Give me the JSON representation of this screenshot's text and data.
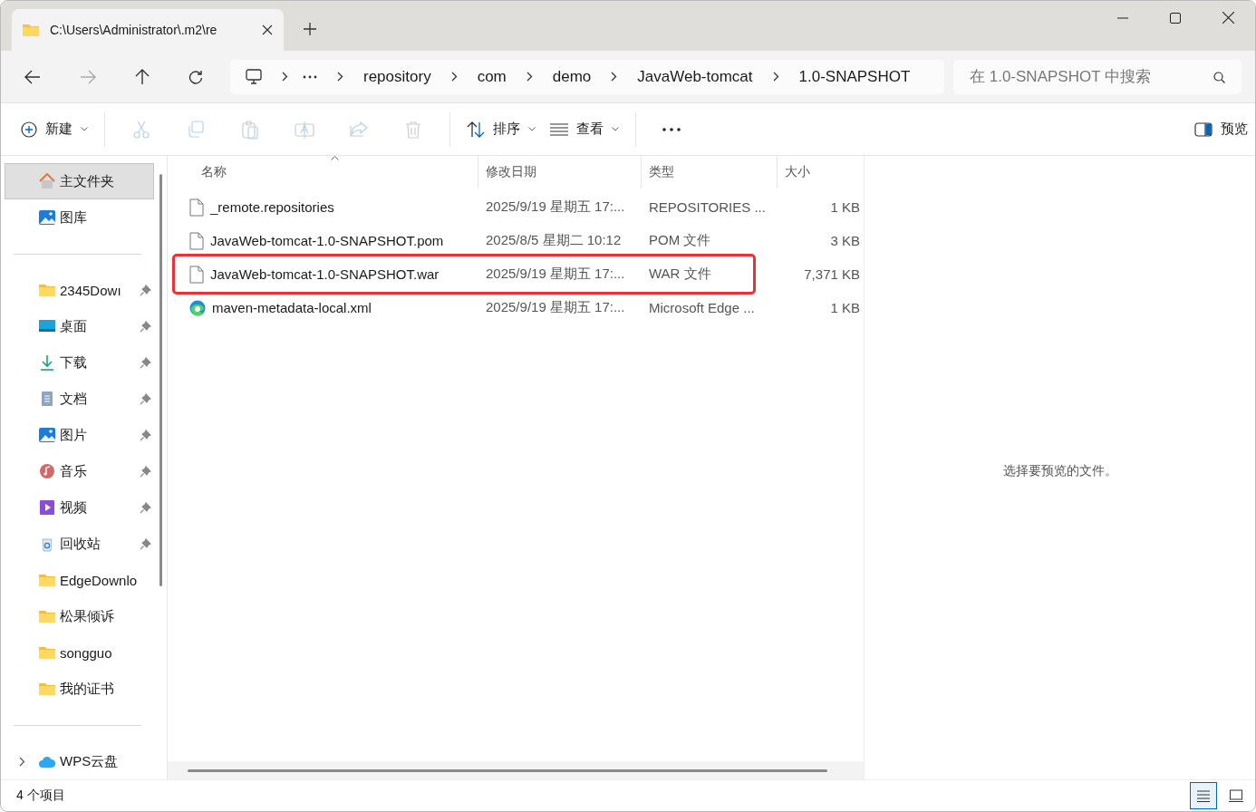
{
  "window": {
    "tab_title": "C:\\Users\\Administrator\\.m2\\re"
  },
  "navigation": {
    "forward_disabled": true
  },
  "address": {
    "crumbs": [
      "repository",
      "com",
      "demo",
      "JavaWeb-tomcat",
      "1.0-SNAPSHOT"
    ]
  },
  "search": {
    "placeholder": "在 1.0-SNAPSHOT 中搜索"
  },
  "toolbar": {
    "items": [
      {
        "kind": "new",
        "label": "新建",
        "disabled": false
      },
      {
        "kind": "cut",
        "disabled": true
      },
      {
        "kind": "copy",
        "disabled": true
      },
      {
        "kind": "paste",
        "disabled": true
      },
      {
        "kind": "rename",
        "disabled": true
      },
      {
        "kind": "share",
        "disabled": true
      },
      {
        "kind": "delete",
        "disabled": true
      },
      {
        "kind": "sort",
        "label": "排序",
        "disabled": false
      },
      {
        "kind": "view",
        "label": "查看",
        "disabled": false
      },
      {
        "kind": "more"
      }
    ],
    "preview_label": "预览"
  },
  "sidebar": {
    "items": [
      {
        "kind": "home",
        "label": "主文件夹",
        "pinned": false,
        "selected": true
      },
      {
        "kind": "gallery",
        "label": "图库",
        "pinned": false,
        "selected": false
      },
      {
        "kind": "divider"
      },
      {
        "kind": "folder",
        "label": "2345Dowı",
        "pinned": true,
        "selected": false
      },
      {
        "kind": "desktop",
        "label": "桌面",
        "pinned": true,
        "selected": false
      },
      {
        "kind": "download",
        "label": "下载",
        "pinned": true,
        "selected": false
      },
      {
        "kind": "docs",
        "label": "文档",
        "pinned": true,
        "selected": false
      },
      {
        "kind": "pictures",
        "label": "图片",
        "pinned": true,
        "selected": false
      },
      {
        "kind": "music",
        "label": "音乐",
        "pinned": true,
        "selected": false
      },
      {
        "kind": "video",
        "label": "视频",
        "pinned": true,
        "selected": false
      },
      {
        "kind": "recycle",
        "label": "回收站",
        "pinned": true,
        "selected": false
      },
      {
        "kind": "folder",
        "label": "EdgeDownlo",
        "pinned": false,
        "selected": false
      },
      {
        "kind": "folder",
        "label": "松果倾诉",
        "pinned": false,
        "selected": false
      },
      {
        "kind": "folder",
        "label": "songguo",
        "pinned": false,
        "selected": false
      },
      {
        "kind": "folder",
        "label": "我的证书",
        "pinned": false,
        "selected": false
      },
      {
        "kind": "divider"
      },
      {
        "kind": "cloud",
        "label": "WPS云盘",
        "pinned": false,
        "selected": false,
        "expandable": true
      }
    ]
  },
  "table": {
    "columns": [
      "名称",
      "修改日期",
      "类型",
      "大小"
    ],
    "rows": [
      {
        "kind": "file",
        "name": "_remote.repositories",
        "modified": "2025/9/19 星期五 17:...",
        "type": "REPOSITORIES ...",
        "size": "1 KB",
        "highlighted": false
      },
      {
        "kind": "file",
        "name": "JavaWeb-tomcat-1.0-SNAPSHOT.pom",
        "modified": "2025/8/5 星期二 10:12",
        "type": "POM 文件",
        "size": "3 KB",
        "highlighted": false
      },
      {
        "kind": "file",
        "name": "JavaWeb-tomcat-1.0-SNAPSHOT.war",
        "modified": "2025/9/19 星期五 17:...",
        "type": "WAR 文件",
        "size": "7,371 KB",
        "highlighted": true
      },
      {
        "kind": "edge",
        "name": "maven-metadata-local.xml",
        "modified": "2025/9/19 星期五 17:...",
        "type": "Microsoft Edge ...",
        "size": "1 KB",
        "highlighted": false
      }
    ]
  },
  "preview": {
    "message": "选择要预览的文件。"
  },
  "status_bar": {
    "count": "4 个项目",
    "views": [
      {
        "kind": "details",
        "selected": true
      },
      {
        "kind": "tiles",
        "selected": false
      }
    ]
  }
}
